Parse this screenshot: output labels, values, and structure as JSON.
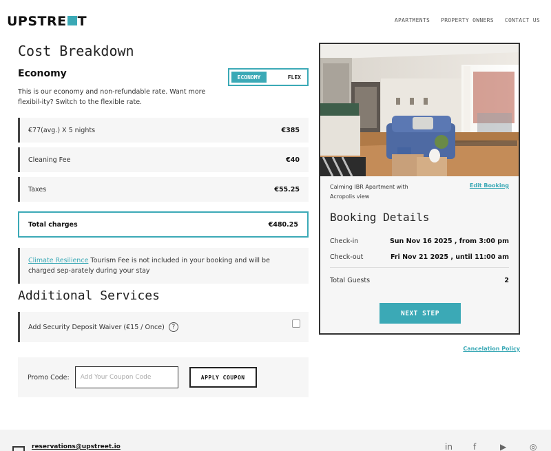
{
  "header": {
    "logo_part1": "UPSTRE",
    "logo_part2": "T",
    "nav": [
      "APARTMENTS",
      "PROPERTY OWNERS",
      "CONTACT US"
    ]
  },
  "cost": {
    "title": "Cost Breakdown",
    "plan_title": "Economy",
    "plan_description": "This is our economy and non-refundable rate. Want more flexibil-ity? Switch to the flexible rate.",
    "toggle": {
      "active": "ECONOMY",
      "inactive": "FLEX"
    },
    "rows": [
      {
        "label": "€77(avg.) X 5 nights",
        "value": "€385"
      },
      {
        "label": "Cleaning Fee",
        "value": "€40"
      },
      {
        "label": "Taxes",
        "value": "€55.25"
      }
    ],
    "total": {
      "label": "Total charges",
      "value": "€480.25"
    },
    "note_link": "Climate Resilience",
    "note_text": " Tourism Fee is not included in your booking and will be charged sep-arately during your stay"
  },
  "services": {
    "title": "Additional Services",
    "deposit_label": "Add Security Deposit Waiver (€15 / Once)",
    "help_glyph": "?"
  },
  "promo": {
    "label": "Promo Code:",
    "placeholder": "Add Your Coupon Code",
    "value": "",
    "button": "APPLY COUPON"
  },
  "booking": {
    "apartment_name": "Calming IBR Apartment with Acropolis view",
    "edit_link": "Edit Booking",
    "title": "Booking Details",
    "checkin_label": "Check-in",
    "checkin_value": "Sun Nov 16 2025 , from 3:00 pm",
    "checkout_label": "Check-out",
    "checkout_value": "Fri Nov 21 2025 , until 11:00 am",
    "guests_label": "Total Guests",
    "guests_value": "2",
    "next_button": "NEXT STEP",
    "cancel_link": "Cancelation Policy"
  },
  "footer": {
    "email": "reservations@upstreet.io",
    "social_icons": [
      "linkedin-icon",
      "facebook-icon",
      "youtube-icon",
      "instagram-icon"
    ],
    "social_glyphs": [
      "in",
      "f",
      "▶",
      "◎"
    ]
  },
  "colors": {
    "accent": "#3ba9b6",
    "dark": "#333333",
    "panel": "#f6f6f6"
  }
}
